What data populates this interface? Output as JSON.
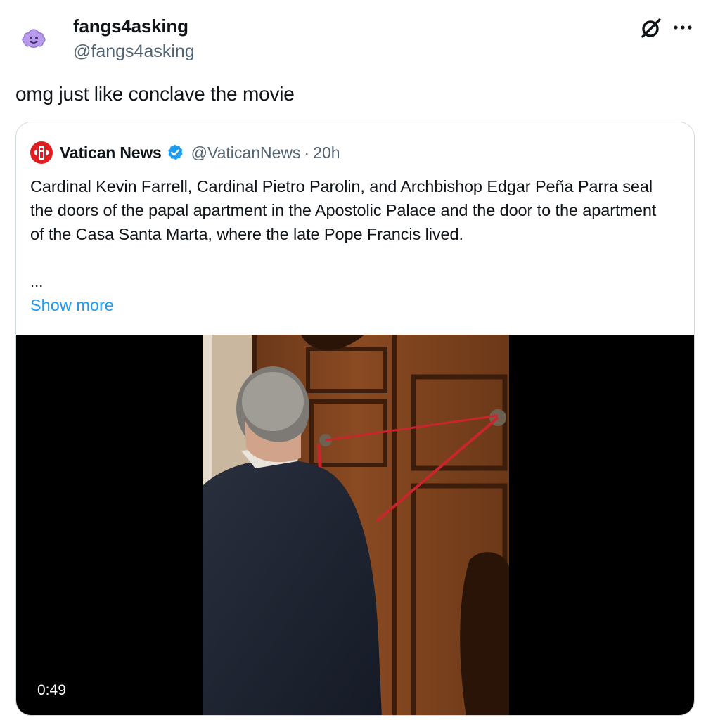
{
  "post": {
    "author": {
      "display_name": "fangs4asking",
      "handle": "@fangs4asking",
      "avatar_icon": "purple-ghost-avatar"
    },
    "text": "omg just like conclave the movie",
    "icons": [
      "grok-icon",
      "more-icon"
    ]
  },
  "quoted_post": {
    "author": {
      "display_name": "Vatican News",
      "handle": "@VaticanNews",
      "separator": "·",
      "time": "20h",
      "verified": true,
      "logo_icon": "vatican-news-logo"
    },
    "text": "Cardinal Kevin Farrell, Cardinal Pietro Parolin, and Archbishop Edgar Peña Parra seal the doors of the papal apartment in the Apostolic Palace and the door to the apartment of the Casa Santa Marta, where the late Pope Francis lived.",
    "ellipsis": "...",
    "show_more_label": "Show more",
    "video": {
      "duration": "0:49"
    }
  },
  "colors": {
    "text_primary": "#0f1419",
    "text_secondary": "#536471",
    "link_blue": "#1d9bf0",
    "verified_blue": "#1d9bf0",
    "border": "#cfd9de",
    "vatican_red": "#e01e22"
  }
}
